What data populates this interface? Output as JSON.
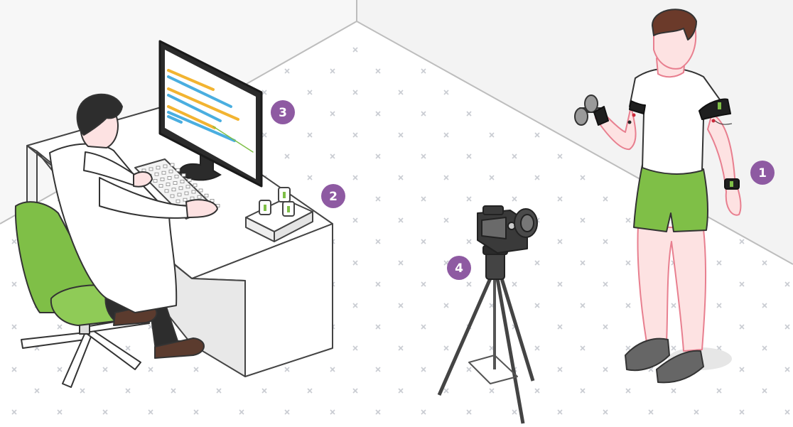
{
  "markers": [
    {
      "label": "1",
      "target": "wearable-sensors"
    },
    {
      "label": "2",
      "target": "sensor-charging-dock"
    },
    {
      "label": "3",
      "target": "computer-monitor"
    },
    {
      "label": "4",
      "target": "camera-on-tripod"
    }
  ],
  "colors": {
    "badge": "#8e5aa2",
    "accent_green": "#7fbf47",
    "chart_orange": "#f2b431",
    "chart_blue": "#4aaee0",
    "floor_mark": "#c9ccd2",
    "skin": "#fde2e2",
    "outline": "#333333"
  },
  "icons": [
    "x-pattern-floor",
    "wall-corner",
    "desk",
    "office-chair",
    "scientist",
    "monitor",
    "keyboard",
    "charging-dock",
    "camera",
    "tripod",
    "dumbbell",
    "subject-person",
    "armband-sensor",
    "wrist-sensor"
  ]
}
